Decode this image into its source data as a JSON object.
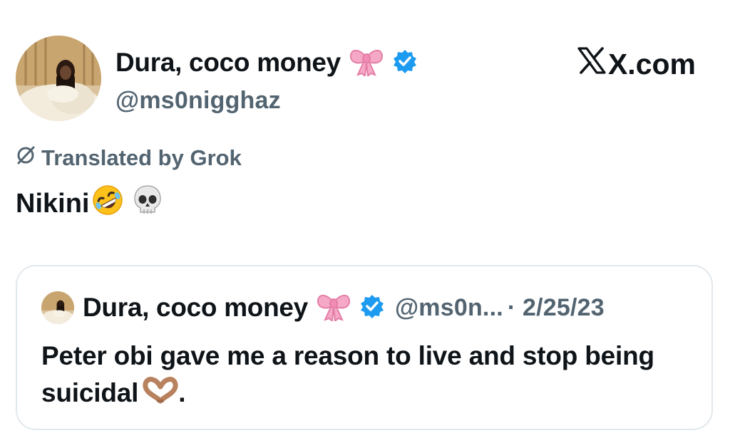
{
  "tweet": {
    "author_name": "Dura, coco money",
    "author_handle": "@ms0nigghaz",
    "site_label": "X.com",
    "translation_note": "Translated by Grok",
    "text": "Nikini",
    "icons": [
      "avatar-photo",
      "pink-bow-emoji",
      "verified-badge-icon",
      "grok-icon",
      "rofl-emoji",
      "skull-emoji"
    ]
  },
  "quoted_tweet": {
    "author_name": "Dura, coco money",
    "author_handle_truncated": "@ms0n...",
    "date_line": "· 2/25/23",
    "text": "Peter obi gave me a reason to live and stop being suicidal",
    "text_suffix": ".",
    "icons": [
      "avatar-photo",
      "pink-bow-emoji",
      "verified-badge-icon",
      "heart-hands-emoji"
    ]
  },
  "colors": {
    "text_primary": "#0f1419",
    "text_secondary": "#536471",
    "verified_blue": "#1d9bf0",
    "card_border": "#e1e8ed"
  }
}
